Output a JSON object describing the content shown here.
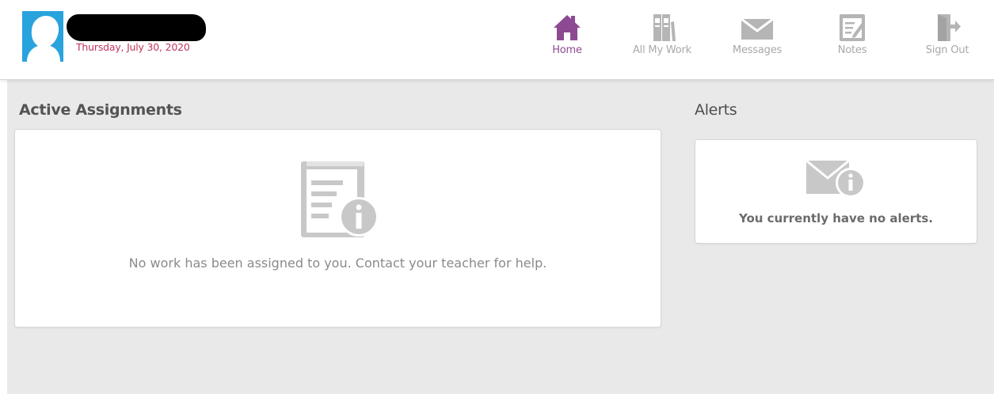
{
  "header": {
    "date": "Thursday, July 30, 2020",
    "nav": [
      {
        "label": "Home",
        "icon": "home-icon",
        "active": true
      },
      {
        "label": "All My Work",
        "icon": "books-icon",
        "active": false
      },
      {
        "label": "Messages",
        "icon": "envelope-icon",
        "active": false
      },
      {
        "label": "Notes",
        "icon": "notepad-edit-icon",
        "active": false
      },
      {
        "label": "Sign Out",
        "icon": "sign-out-icon",
        "active": false
      }
    ]
  },
  "assignments": {
    "title": "Active Assignments",
    "empty_message": "No work has been assigned to you. Contact your teacher for help.",
    "icon": "assignment-info-icon"
  },
  "alerts": {
    "title": "Alerts",
    "empty_message": "You currently have no alerts.",
    "icon": "envelope-info-icon"
  },
  "colors": {
    "accent": "#8d4a93",
    "date": "#c0365c",
    "icon_gray": "#b5b5b5",
    "avatar_bg": "#29a3dd"
  }
}
